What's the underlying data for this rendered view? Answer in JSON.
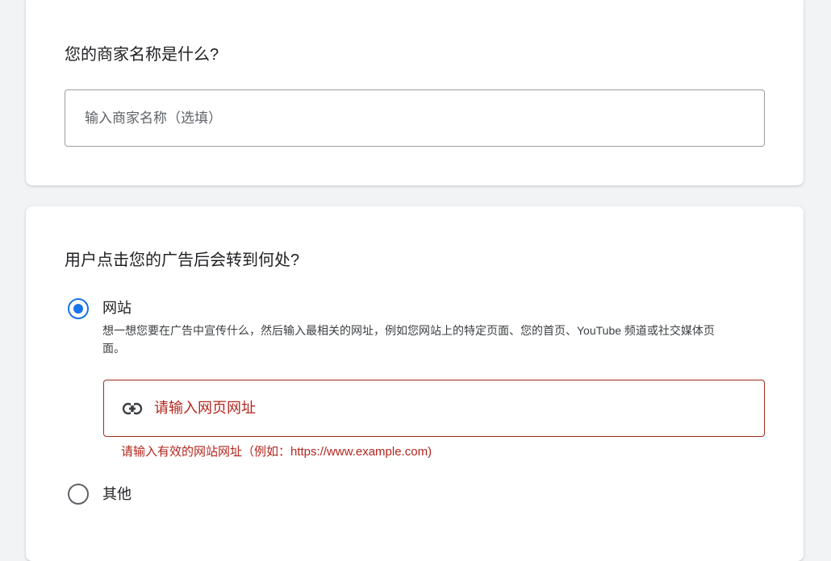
{
  "business_name_section": {
    "question": "您的商家名称是什么?",
    "input_placeholder": "输入商家名称（选填）",
    "input_value": ""
  },
  "destination_section": {
    "question": "用户点击您的广告后会转到何处?",
    "options": [
      {
        "label": "网站",
        "selected": true,
        "description": "想一想您要在广告中宣传什么，然后输入最相关的网址，例如您网站上的特定页面、您的首页、YouTube 频道或社交媒体页面。",
        "url_input": {
          "icon": "link-icon",
          "placeholder": "请输入网页网址",
          "value": "",
          "error": "请输入有效的网站网址（例如：https://www.example.com)"
        }
      },
      {
        "label": "其他",
        "selected": false
      }
    ]
  },
  "colors": {
    "accent": "#1a73e8",
    "error": "#b3261e",
    "background": "#f1f3f4",
    "card": "#ffffff"
  }
}
